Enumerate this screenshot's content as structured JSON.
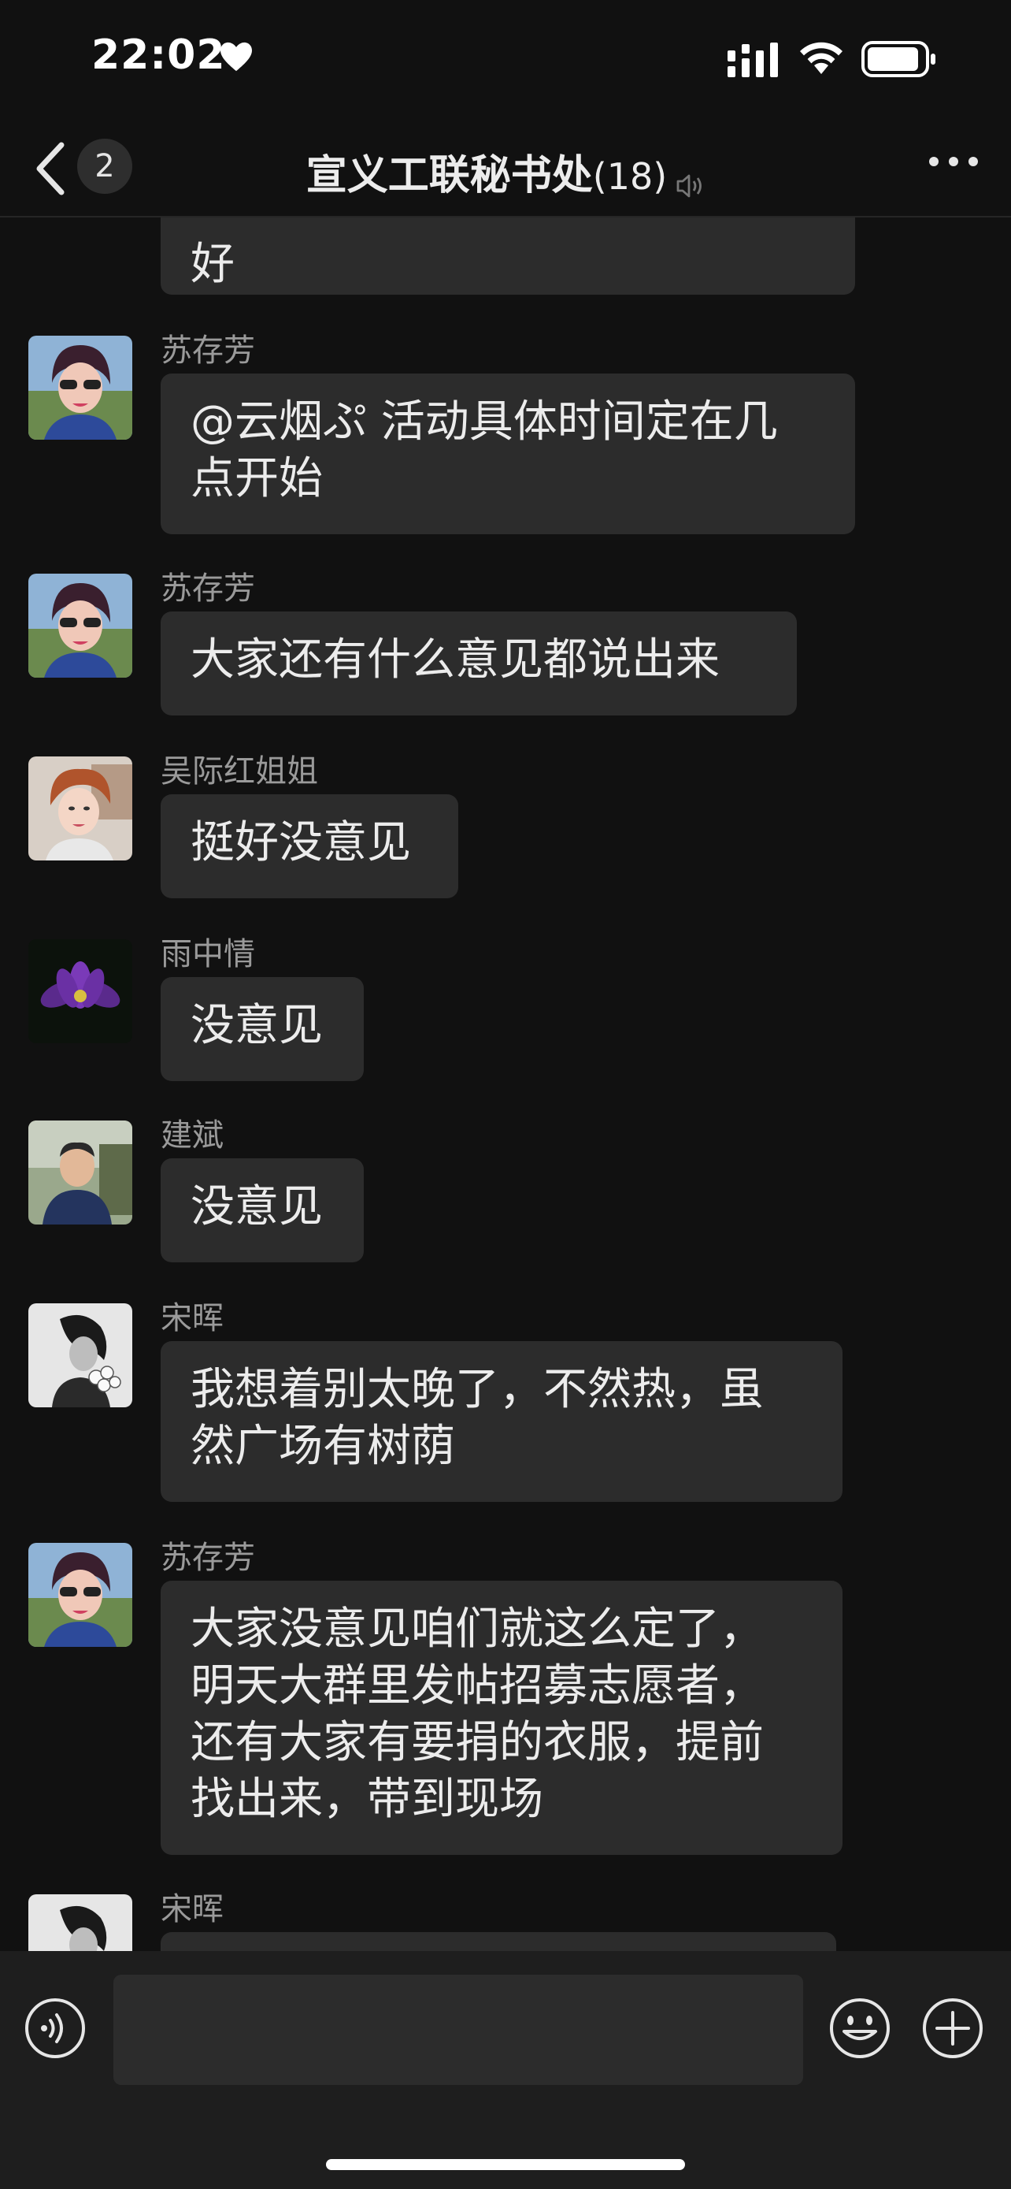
{
  "status_bar": {
    "time": "22:02",
    "icons": [
      "heart-icon",
      "cellular-signal-icon",
      "wifi-icon",
      "battery-icon"
    ]
  },
  "nav": {
    "back_icon": "chevron-left-icon",
    "back_badge": "2",
    "title": "宣义工联秘书处",
    "member_count": "(18)",
    "mute_icon": "speaker-muted-icon",
    "more_icon": "ellipsis-icon"
  },
  "messages": [
    {
      "sender": "",
      "avatar": "none",
      "lines": [
        "好"
      ]
    },
    {
      "sender": "苏存芳",
      "avatar": "woman-sunglasses-photo",
      "lines": [
        "@云烟ぷ 活动具体时间定在几",
        "点开始"
      ]
    },
    {
      "sender": "苏存芳",
      "avatar": "woman-sunglasses-photo",
      "lines": [
        "大家还有什么意见都说出来"
      ]
    },
    {
      "sender": "吴际红姐姐",
      "avatar": "woman-short-hair-photo",
      "lines": [
        "挺好没意见"
      ]
    },
    {
      "sender": "雨中情",
      "avatar": "purple-lotus-photo",
      "lines": [
        "没意见"
      ]
    },
    {
      "sender": "建斌",
      "avatar": "man-outdoor-photo",
      "lines": [
        "没意见"
      ]
    },
    {
      "sender": "宋晖",
      "avatar": "woman-flowers-bw-photo",
      "lines": [
        "我想着别太晚了，不然热，虽",
        "然广场有树荫"
      ]
    },
    {
      "sender": "苏存芳",
      "avatar": "woman-sunglasses-photo",
      "lines": [
        "大家没意见咱们就这么定了，",
        "明天大群里发帖招募志愿者，",
        "还有大家有要捐的衣服，提前",
        "找出来，带到现场"
      ]
    },
    {
      "sender": "宋晖",
      "avatar": "woman-flowers-bw-photo",
      "lines": []
    }
  ],
  "input_bar": {
    "voice_icon": "voice-input-icon",
    "message_value": "",
    "emoji_icon": "emoji-icon",
    "plus_icon": "plus-circle-icon"
  },
  "colors": {
    "background": "#111111",
    "bubble": "#2c2c2c",
    "input_bar": "#1e1e1e",
    "text": "#ececec",
    "sender_text": "#9a9a9a"
  }
}
